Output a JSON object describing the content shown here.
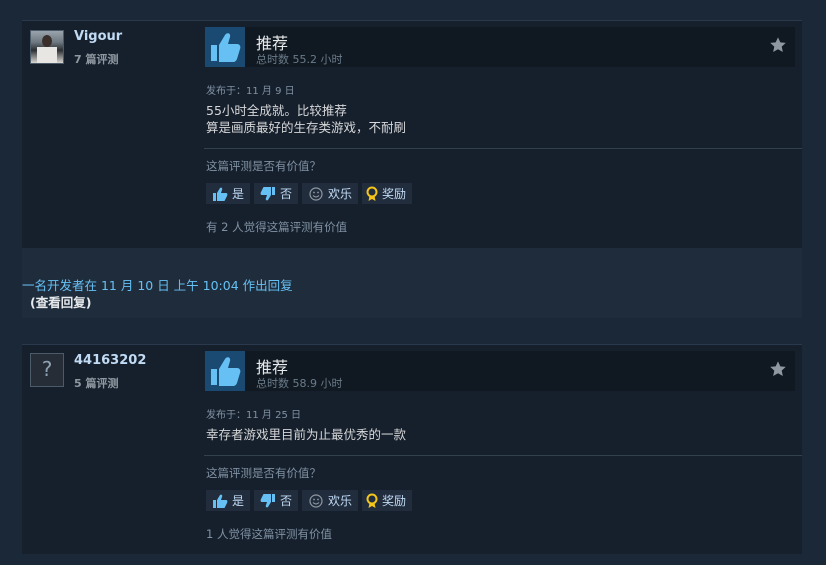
{
  "reviews": [
    {
      "user": {
        "name": "Vigour",
        "count": "7 篇评测"
      },
      "verdict": {
        "title": "推荐",
        "hours": "总时数 55.2 小时"
      },
      "posted": "发布于：11 月 9 日",
      "text": "55小时全成就。比较推荐\n算是画质最好的生存类游戏，不耐刷",
      "help_question": "这篇评测是否有价值？",
      "buttons": {
        "yes": "是",
        "no": "否",
        "funny": "欢乐",
        "award": "奖励"
      },
      "helpful": "有 2 人觉得这篇评测有价值"
    },
    {
      "user": {
        "name": "44163202",
        "count": "5 篇评测",
        "avatar_glyph": "?"
      },
      "verdict": {
        "title": "推荐",
        "hours": "总时数 58.9 小时"
      },
      "posted": "发布于：11 月 25 日",
      "text": "幸存者游戏里目前为止最优秀的一款",
      "help_question": "这篇评测是否有价值？",
      "buttons": {
        "yes": "是",
        "no": "否",
        "funny": "欢乐",
        "award": "奖励"
      },
      "helpful": "1 人觉得这篇评测有价值"
    }
  ],
  "developer_response": {
    "text": "一名开发者在 11 月 10 日 上午 10:04 作出回复",
    "link": "(查看回复)"
  },
  "colors": {
    "background": "#1b2838",
    "card": "#16202d",
    "link": "#66c0f4",
    "thumb_bg": "#1a4a72",
    "award": "#f5c518"
  },
  "icons": [
    "thumbs-up-icon",
    "star-icon",
    "thumbs-up-small-icon",
    "thumbs-down-small-icon",
    "smiley-icon",
    "award-icon"
  ]
}
